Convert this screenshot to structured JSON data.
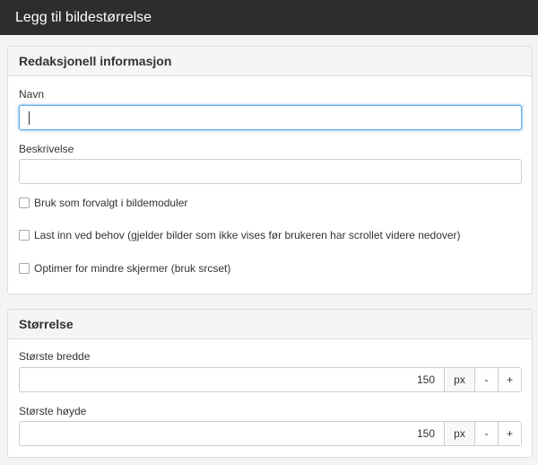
{
  "window": {
    "title": "Legg til bildestørrelse"
  },
  "editorial": {
    "heading": "Redaksjonell informasjon",
    "name_label": "Navn",
    "name_value": "",
    "description_label": "Beskrivelse",
    "description_value": "",
    "checkboxes": [
      {
        "label": "Bruk som forvalgt i bildemoduler",
        "checked": false
      },
      {
        "label": "Last inn ved behov (gjelder bilder som ikke vises før brukeren har scrollet videre nedover)",
        "checked": false
      },
      {
        "label": "Optimer for mindre skjermer (bruk srcset)",
        "checked": false
      }
    ]
  },
  "size": {
    "heading": "Størrelse",
    "max_width": {
      "label": "Største bredde",
      "value": "150",
      "unit": "px",
      "decrement": "-",
      "increment": "+"
    },
    "max_height": {
      "label": "Største høyde",
      "value": "150",
      "unit": "px",
      "decrement": "-",
      "increment": "+"
    }
  }
}
